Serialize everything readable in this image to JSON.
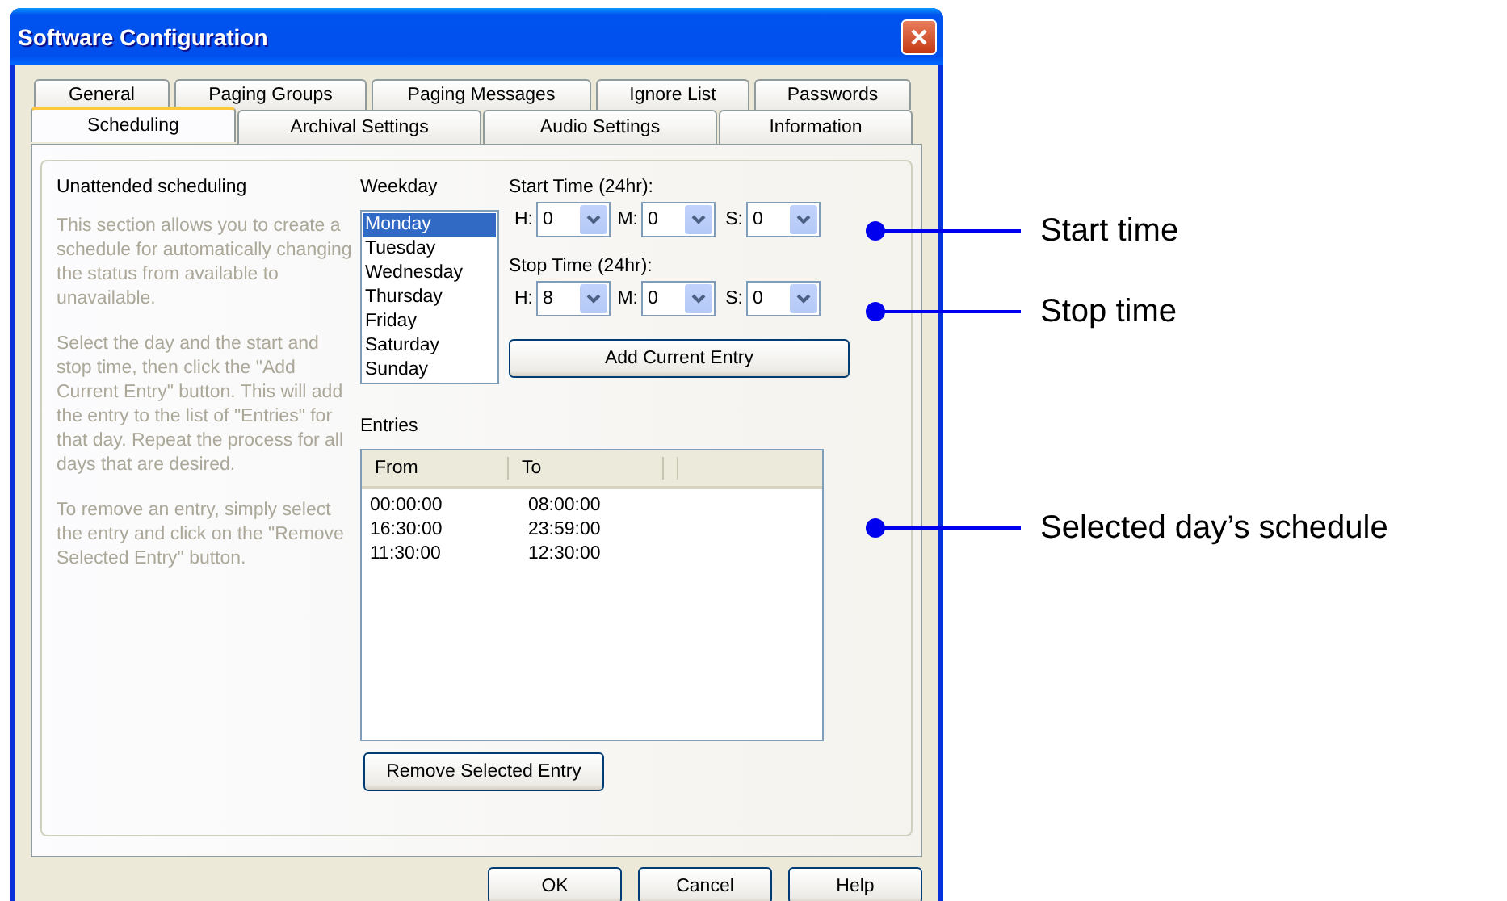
{
  "window": {
    "title": "Software Configuration"
  },
  "tab_rows": [
    [
      {
        "label": "General",
        "selected": false
      },
      {
        "label": "Paging Groups",
        "selected": false
      },
      {
        "label": "Paging Messages",
        "selected": false
      },
      {
        "label": "Ignore List",
        "selected": false
      },
      {
        "label": "Passwords",
        "selected": false
      }
    ],
    [
      {
        "label": "Scheduling",
        "selected": true
      },
      {
        "label": "Archival Settings",
        "selected": false
      },
      {
        "label": "Audio Settings",
        "selected": false
      },
      {
        "label": "Information",
        "selected": false
      }
    ]
  ],
  "section": {
    "heading": "Unattended scheduling",
    "paragraphs": [
      "This section allows you to create a schedule for automatically changing the status from available to unavailable.",
      "Select the day and the start and stop time, then click the \"Add Current Entry\" button.  This will add the entry to the list of \"Entries\" for that day.  Repeat the process for all days that are desired.",
      "To remove an entry, simply select the entry and click on the \"Remove Selected Entry\" button."
    ]
  },
  "weekday": {
    "label": "Weekday",
    "days": [
      {
        "label": "Monday",
        "selected": true
      },
      {
        "label": "Tuesday",
        "selected": false
      },
      {
        "label": "Wednesday",
        "selected": false
      },
      {
        "label": "Thursday",
        "selected": false
      },
      {
        "label": "Friday",
        "selected": false
      },
      {
        "label": "Saturday",
        "selected": false
      },
      {
        "label": "Sunday",
        "selected": false
      }
    ]
  },
  "start_time": {
    "label": "Start Time (24hr):",
    "fields": [
      {
        "label": "H:",
        "value": "0"
      },
      {
        "label": "M:",
        "value": "0"
      },
      {
        "label": "S:",
        "value": "0"
      }
    ]
  },
  "stop_time": {
    "label": "Stop Time (24hr):",
    "fields": [
      {
        "label": "H:",
        "value": "8"
      },
      {
        "label": "M:",
        "value": "0"
      },
      {
        "label": "S:",
        "value": "0"
      }
    ]
  },
  "add_button": "Add Current Entry",
  "entries": {
    "label": "Entries",
    "columns": [
      "From",
      "To"
    ],
    "rows": [
      [
        "00:00:00",
        "08:00:00"
      ],
      [
        "16:30:00",
        "23:59:00"
      ],
      [
        "11:30:00",
        "12:30:00"
      ]
    ]
  },
  "remove_button": "Remove Selected Entry",
  "buttons": [
    "OK",
    "Cancel",
    "Help"
  ],
  "callouts": [
    {
      "label": "Start time"
    },
    {
      "label": "Stop time"
    },
    {
      "label": "Selected day’s schedule"
    }
  ]
}
